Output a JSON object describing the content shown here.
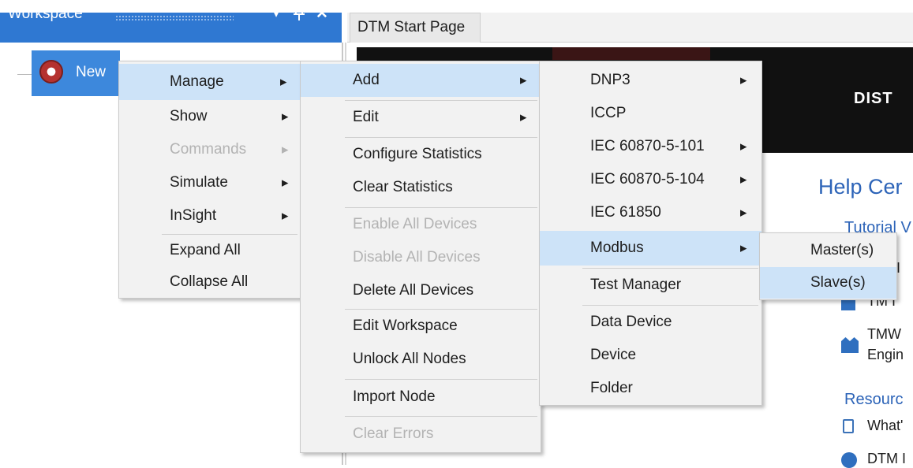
{
  "workspace": {
    "title": "Workspace",
    "dropdown_icon": "chevron-down-icon",
    "pin_icon": "pin-icon",
    "close_icon": "close-icon",
    "node_label": "New"
  },
  "tabs": [
    {
      "label": "DTM Start Page"
    }
  ],
  "start_page": {
    "banner_text": "DIST",
    "help_title": "Help Cer",
    "tutorial_heading": "Tutorial V",
    "links": [
      "M I",
      "TM I",
      "TMW",
      "Engin"
    ],
    "resources_heading": "Resourc",
    "resource_links": [
      "What'",
      "DTM I"
    ]
  },
  "menus": {
    "main": [
      {
        "label": "Manage",
        "submenu": true,
        "highlighted": true
      },
      {
        "label": "Show",
        "submenu": true
      },
      {
        "label": "Commands",
        "submenu": true,
        "disabled": true
      },
      {
        "label": "Simulate",
        "submenu": true
      },
      {
        "label": "InSight",
        "submenu": true
      },
      {
        "label": "Expand All"
      },
      {
        "label": "Collapse All"
      }
    ],
    "manage": [
      {
        "label": "Add",
        "submenu": true,
        "highlighted": true
      },
      {
        "label": "Edit",
        "submenu": true
      },
      {
        "label": "Configure Statistics"
      },
      {
        "label": "Clear Statistics"
      },
      {
        "label": "Enable All Devices",
        "disabled": true
      },
      {
        "label": "Disable All Devices",
        "disabled": true
      },
      {
        "label": "Delete All Devices"
      },
      {
        "label": "Edit Workspace"
      },
      {
        "label": "Unlock All Nodes"
      },
      {
        "label": "Import Node"
      },
      {
        "label": "Clear Errors",
        "disabled": true
      }
    ],
    "add": [
      {
        "label": "DNP3",
        "submenu": true
      },
      {
        "label": "ICCP"
      },
      {
        "label": "IEC 60870-5-101",
        "submenu": true
      },
      {
        "label": "IEC 60870-5-104",
        "submenu": true
      },
      {
        "label": "IEC 61850",
        "submenu": true
      },
      {
        "label": "Modbus",
        "submenu": true,
        "highlighted": true
      },
      {
        "label": "Test Manager"
      },
      {
        "label": "Data Device"
      },
      {
        "label": "Device"
      },
      {
        "label": "Folder"
      }
    ],
    "modbus": [
      {
        "label": "Master(s)"
      },
      {
        "label": "Slave(s)",
        "highlighted": true
      }
    ]
  }
}
